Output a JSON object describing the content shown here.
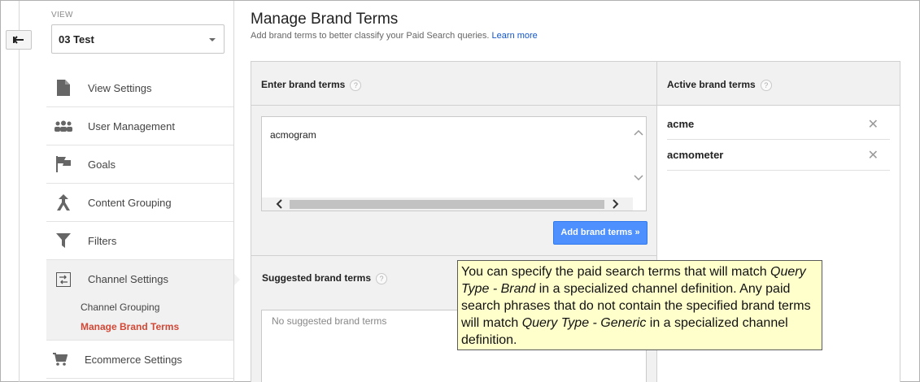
{
  "sidebar": {
    "view_label": "VIEW",
    "view_value": "03 Test",
    "items": [
      {
        "label": "View Settings",
        "icon": "document-icon"
      },
      {
        "label": "User Management",
        "icon": "users-icon"
      },
      {
        "label": "Goals",
        "icon": "flag-icon"
      },
      {
        "label": "Content Grouping",
        "icon": "content-grouping-icon"
      },
      {
        "label": "Filters",
        "icon": "filter-icon"
      },
      {
        "label": "Channel Settings",
        "icon": "channel-settings-icon"
      },
      {
        "label": "Ecommerce Settings",
        "icon": "cart-icon"
      }
    ],
    "sub_items": [
      {
        "label": "Channel Grouping"
      },
      {
        "label": "Manage Brand Terms",
        "selected": true
      }
    ]
  },
  "main": {
    "title": "Manage Brand Terms",
    "subtitle": "Add brand terms to better classify your Paid Search queries.",
    "learn_more": "Learn more",
    "enter_header": "Enter brand terms",
    "input_value": "acmogram",
    "add_button": "Add brand terms »",
    "suggested_header": "Suggested brand terms",
    "suggested_placeholder": "No suggested brand terms",
    "active_header": "Active brand terms",
    "active_terms": [
      "acme",
      "acmometer"
    ],
    "help_glyph": "?",
    "remove_glyph": "✕"
  },
  "tooltip": {
    "part1": "You can specify the paid search terms that will match",
    "em1": "Query Type - Brand",
    "part2": "in a specialized channel definition. Any paid search phrases that do not contain the specified brand terms will match",
    "em2": "Query Type - Generic",
    "part3": "in a specialized channel definition."
  },
  "colors": {
    "accent_blue": "#4d90fe",
    "selected_red": "#d14836",
    "tooltip_bg": "#ffffcc"
  }
}
